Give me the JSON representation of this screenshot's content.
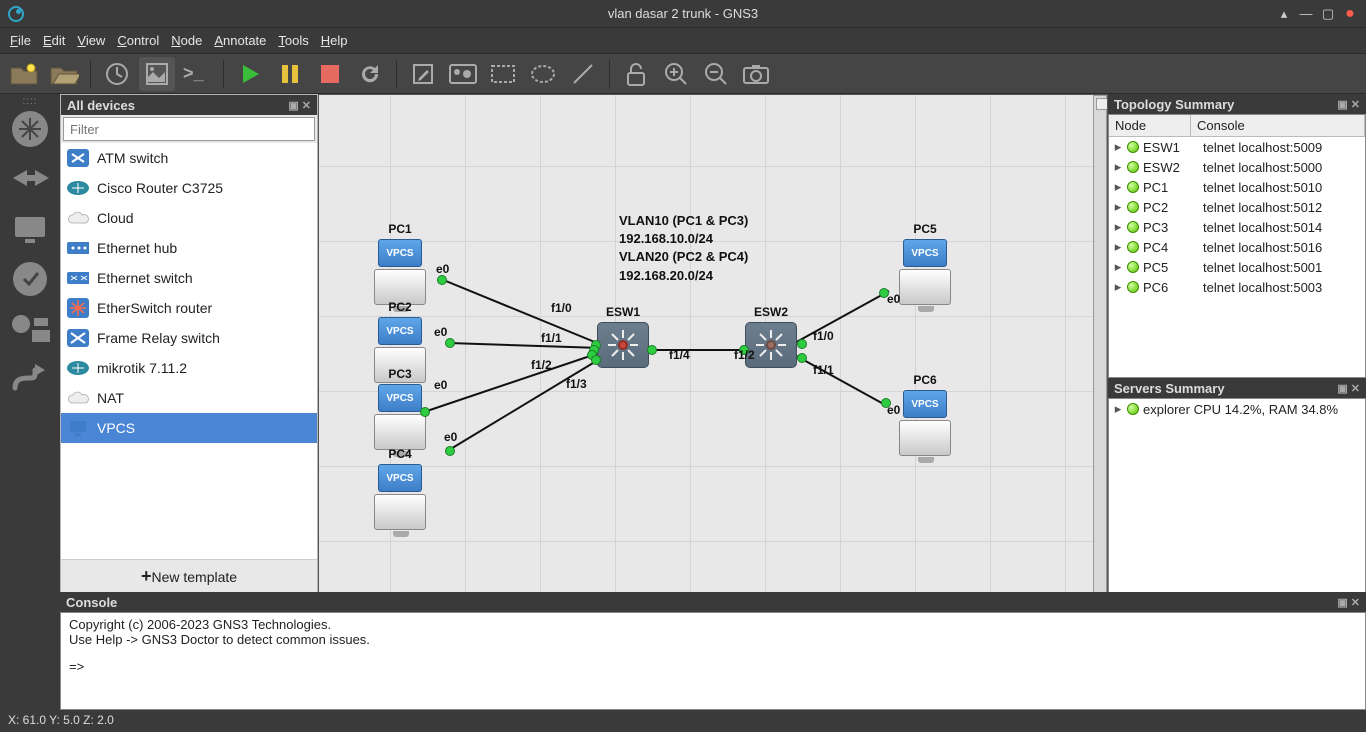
{
  "window": {
    "title": "vlan dasar 2 trunk - GNS3"
  },
  "menu": {
    "file": "File",
    "edit": "Edit",
    "view": "View",
    "control": "Control",
    "node": "Node",
    "annotate": "Annotate",
    "tools": "Tools",
    "help": "Help"
  },
  "devices_panel": {
    "title": "All devices",
    "filter_placeholder": "Filter",
    "items": [
      {
        "label": "ATM switch",
        "icon": "atm-switch"
      },
      {
        "label": "Cisco Router C3725",
        "icon": "router"
      },
      {
        "label": "Cloud",
        "icon": "cloud"
      },
      {
        "label": "Ethernet hub",
        "icon": "hub"
      },
      {
        "label": "Ethernet switch",
        "icon": "switch"
      },
      {
        "label": "EtherSwitch router",
        "icon": "etherswitch"
      },
      {
        "label": "Frame Relay switch",
        "icon": "frame-relay"
      },
      {
        "label": "mikrotik 7.11.2",
        "icon": "router"
      },
      {
        "label": "NAT",
        "icon": "cloud"
      },
      {
        "label": "VPCS",
        "icon": "vpcs",
        "selected": true
      }
    ],
    "new_template": "New template"
  },
  "topology_summary": {
    "title": "Topology Summary",
    "headers": {
      "node": "Node",
      "console": "Console"
    },
    "rows": [
      {
        "node": "ESW1",
        "console": "telnet localhost:5009"
      },
      {
        "node": "ESW2",
        "console": "telnet localhost:5000"
      },
      {
        "node": "PC1",
        "console": "telnet localhost:5010"
      },
      {
        "node": "PC2",
        "console": "telnet localhost:5012"
      },
      {
        "node": "PC3",
        "console": "telnet localhost:5014"
      },
      {
        "node": "PC4",
        "console": "telnet localhost:5016"
      },
      {
        "node": "PC5",
        "console": "telnet localhost:5001"
      },
      {
        "node": "PC6",
        "console": "telnet localhost:5003"
      }
    ]
  },
  "servers_summary": {
    "title": "Servers Summary",
    "row": "explorer CPU 14.2%, RAM 34.8%"
  },
  "console": {
    "title": "Console",
    "line1": "Copyright (c) 2006-2023 GNS3 Technologies.",
    "line2": "Use Help -> GNS3 Doctor to detect common issues.",
    "prompt": "=>"
  },
  "statusbar": "X: 61.0 Y: 5.0 Z: 2.0",
  "canvas": {
    "labels": {
      "PC1": "PC1",
      "PC2": "PC2",
      "PC3": "PC3",
      "PC4": "PC4",
      "PC5": "PC5",
      "PC6": "PC6",
      "ESW1": "ESW1",
      "ESW2": "ESW2",
      "e0": "e0",
      "f10": "f1/0",
      "f11": "f1/1",
      "f12": "f1/2",
      "f13": "f1/3",
      "f14": "f1/4",
      "vpcs": "VPCS"
    },
    "text": {
      "l1": "VLAN10 (PC1 & PC3)",
      "l2": "192.168.10.0/24",
      "l3": "VLAN20 (PC2 & PC4)",
      "l4": "192.168.20.0/24"
    }
  }
}
